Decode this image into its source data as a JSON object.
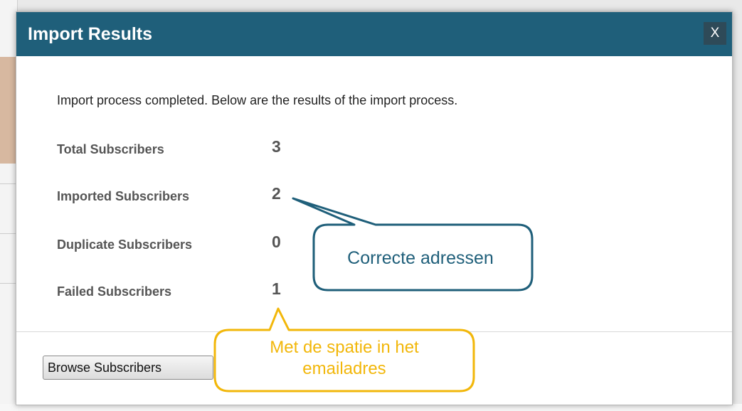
{
  "dialog": {
    "title": "Import Results",
    "close_label": "X",
    "intro": "Import process completed. Below are the results of the import process."
  },
  "stats": [
    {
      "label": "Total Subscribers",
      "value": "3"
    },
    {
      "label": "Imported Subscribers",
      "value": "2"
    },
    {
      "label": "Duplicate Subscribers",
      "value": "0"
    },
    {
      "label": "Failed Subscribers",
      "value": "1"
    }
  ],
  "footer": {
    "browse_label": "Browse Subscribers"
  },
  "annotations": {
    "imported_note": "Correcte adressen",
    "failed_note_line1": "Met de spatie in het",
    "failed_note_line2": "emailadres"
  },
  "colors": {
    "titlebar": "#1f5f7a",
    "close_button": "#2e4a58",
    "blue_callout": "#1f5f7a",
    "yellow_callout": "#f2b70a"
  }
}
